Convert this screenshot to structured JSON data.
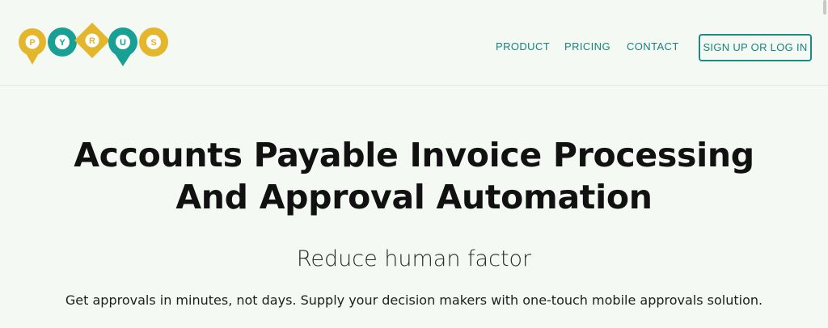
{
  "logo": {
    "letters": [
      "P",
      "Y",
      "R",
      "U",
      "S"
    ],
    "colors": [
      "#e3b62b",
      "#17a093",
      "#e3b62b",
      "#17a093",
      "#e3b62b"
    ]
  },
  "nav": {
    "product": "PRODUCT",
    "pricing": "PRICING",
    "contact": "CONTACT",
    "signup": "SIGN UP OR LOG IN"
  },
  "hero": {
    "title": "Accounts Payable Invoice Processing And Approval Automation",
    "subtitle": "Reduce human factor",
    "description": "Get approvals in minutes, not days. Supply your decision makers with one-touch mobile approvals solution."
  },
  "theme": {
    "accent": "#17847c",
    "background": "#f4f9f4"
  }
}
